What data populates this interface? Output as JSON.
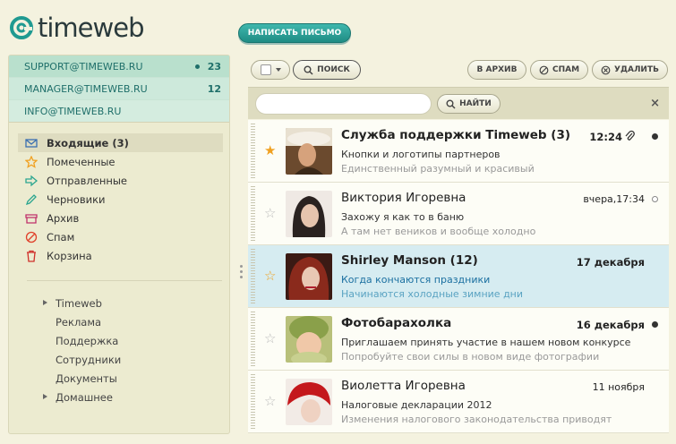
{
  "brand": {
    "name": "timeweb"
  },
  "compose": {
    "label": "НАПИСАТЬ ПИСЬМО"
  },
  "accounts": [
    {
      "address": "SUPPORT@TIMEWEB.RU",
      "count": "23",
      "dot": true
    },
    {
      "address": "MANAGER@TIMEWEB.RU",
      "count": "12",
      "dot": false
    },
    {
      "address": "INFO@TIMEWEB.RU",
      "count": "",
      "dot": false
    }
  ],
  "folders": [
    {
      "label": "Входящие (3)",
      "icon": "envelope-icon"
    },
    {
      "label": "Помеченные",
      "icon": "star-icon"
    },
    {
      "label": "Отправленные",
      "icon": "arrow-right-icon"
    },
    {
      "label": "Черновики",
      "icon": "pencil-icon"
    },
    {
      "label": "Архив",
      "icon": "archive-icon"
    },
    {
      "label": "Спам",
      "icon": "spam-icon"
    },
    {
      "label": "Корзина",
      "icon": "trash-icon"
    }
  ],
  "labels": [
    {
      "label": "Timeweb",
      "expandable": true
    },
    {
      "label": "Реклама",
      "expandable": false
    },
    {
      "label": "Поддержка",
      "expandable": false
    },
    {
      "label": "Сотрудники",
      "expandable": false
    },
    {
      "label": "Документы",
      "expandable": false
    },
    {
      "label": "Домашнее",
      "expandable": true
    }
  ],
  "toolbar": {
    "search": "ПОИСК",
    "archive": "В АРХИВ",
    "spam": "СПАМ",
    "delete": "УДАЛИТЬ"
  },
  "searchbar": {
    "value": "",
    "find": "НАЙТИ",
    "close": "×"
  },
  "messages": [
    {
      "from": "Служба поддержки Timeweb (3)",
      "subject": "Кнопки и логотипы партнеров",
      "preview": "Единственный разумный и красивый",
      "date": "12:24",
      "unread": true,
      "starred": true,
      "attachment": true,
      "selected": false
    },
    {
      "from": "Виктория Игоревна",
      "subject": "Захожу я как то в баню",
      "preview": "А там нет веников и вообще холодно",
      "date": "вчера,17:34",
      "unread": false,
      "starred": false,
      "attachment": false,
      "selected": false
    },
    {
      "from": "Shirley Manson (12)",
      "subject": "Когда кончаются праздники",
      "preview": "Начинаются холодные зимние дни",
      "date": "17 декабря",
      "unread": true,
      "starred": true,
      "attachment": false,
      "selected": true
    },
    {
      "from": "Фотобарахолка",
      "subject": "Приглашаем принять участие в нашем новом конкурсе",
      "preview": "Попробуйте свои силы в новом виде фотографии",
      "date": "16 декабря",
      "unread": true,
      "starred": false,
      "attachment": false,
      "selected": false
    },
    {
      "from": "Виолетта Игоревна",
      "subject": "Налоговые декларации 2012",
      "preview": "Изменения налогового законодательства приводят",
      "date": "11 ноября",
      "unread": false,
      "starred": false,
      "attachment": false,
      "selected": false
    }
  ],
  "colors": {
    "accent": "#1f8c84",
    "selected_row": "#d6ecf1",
    "star": "#f0a020"
  }
}
